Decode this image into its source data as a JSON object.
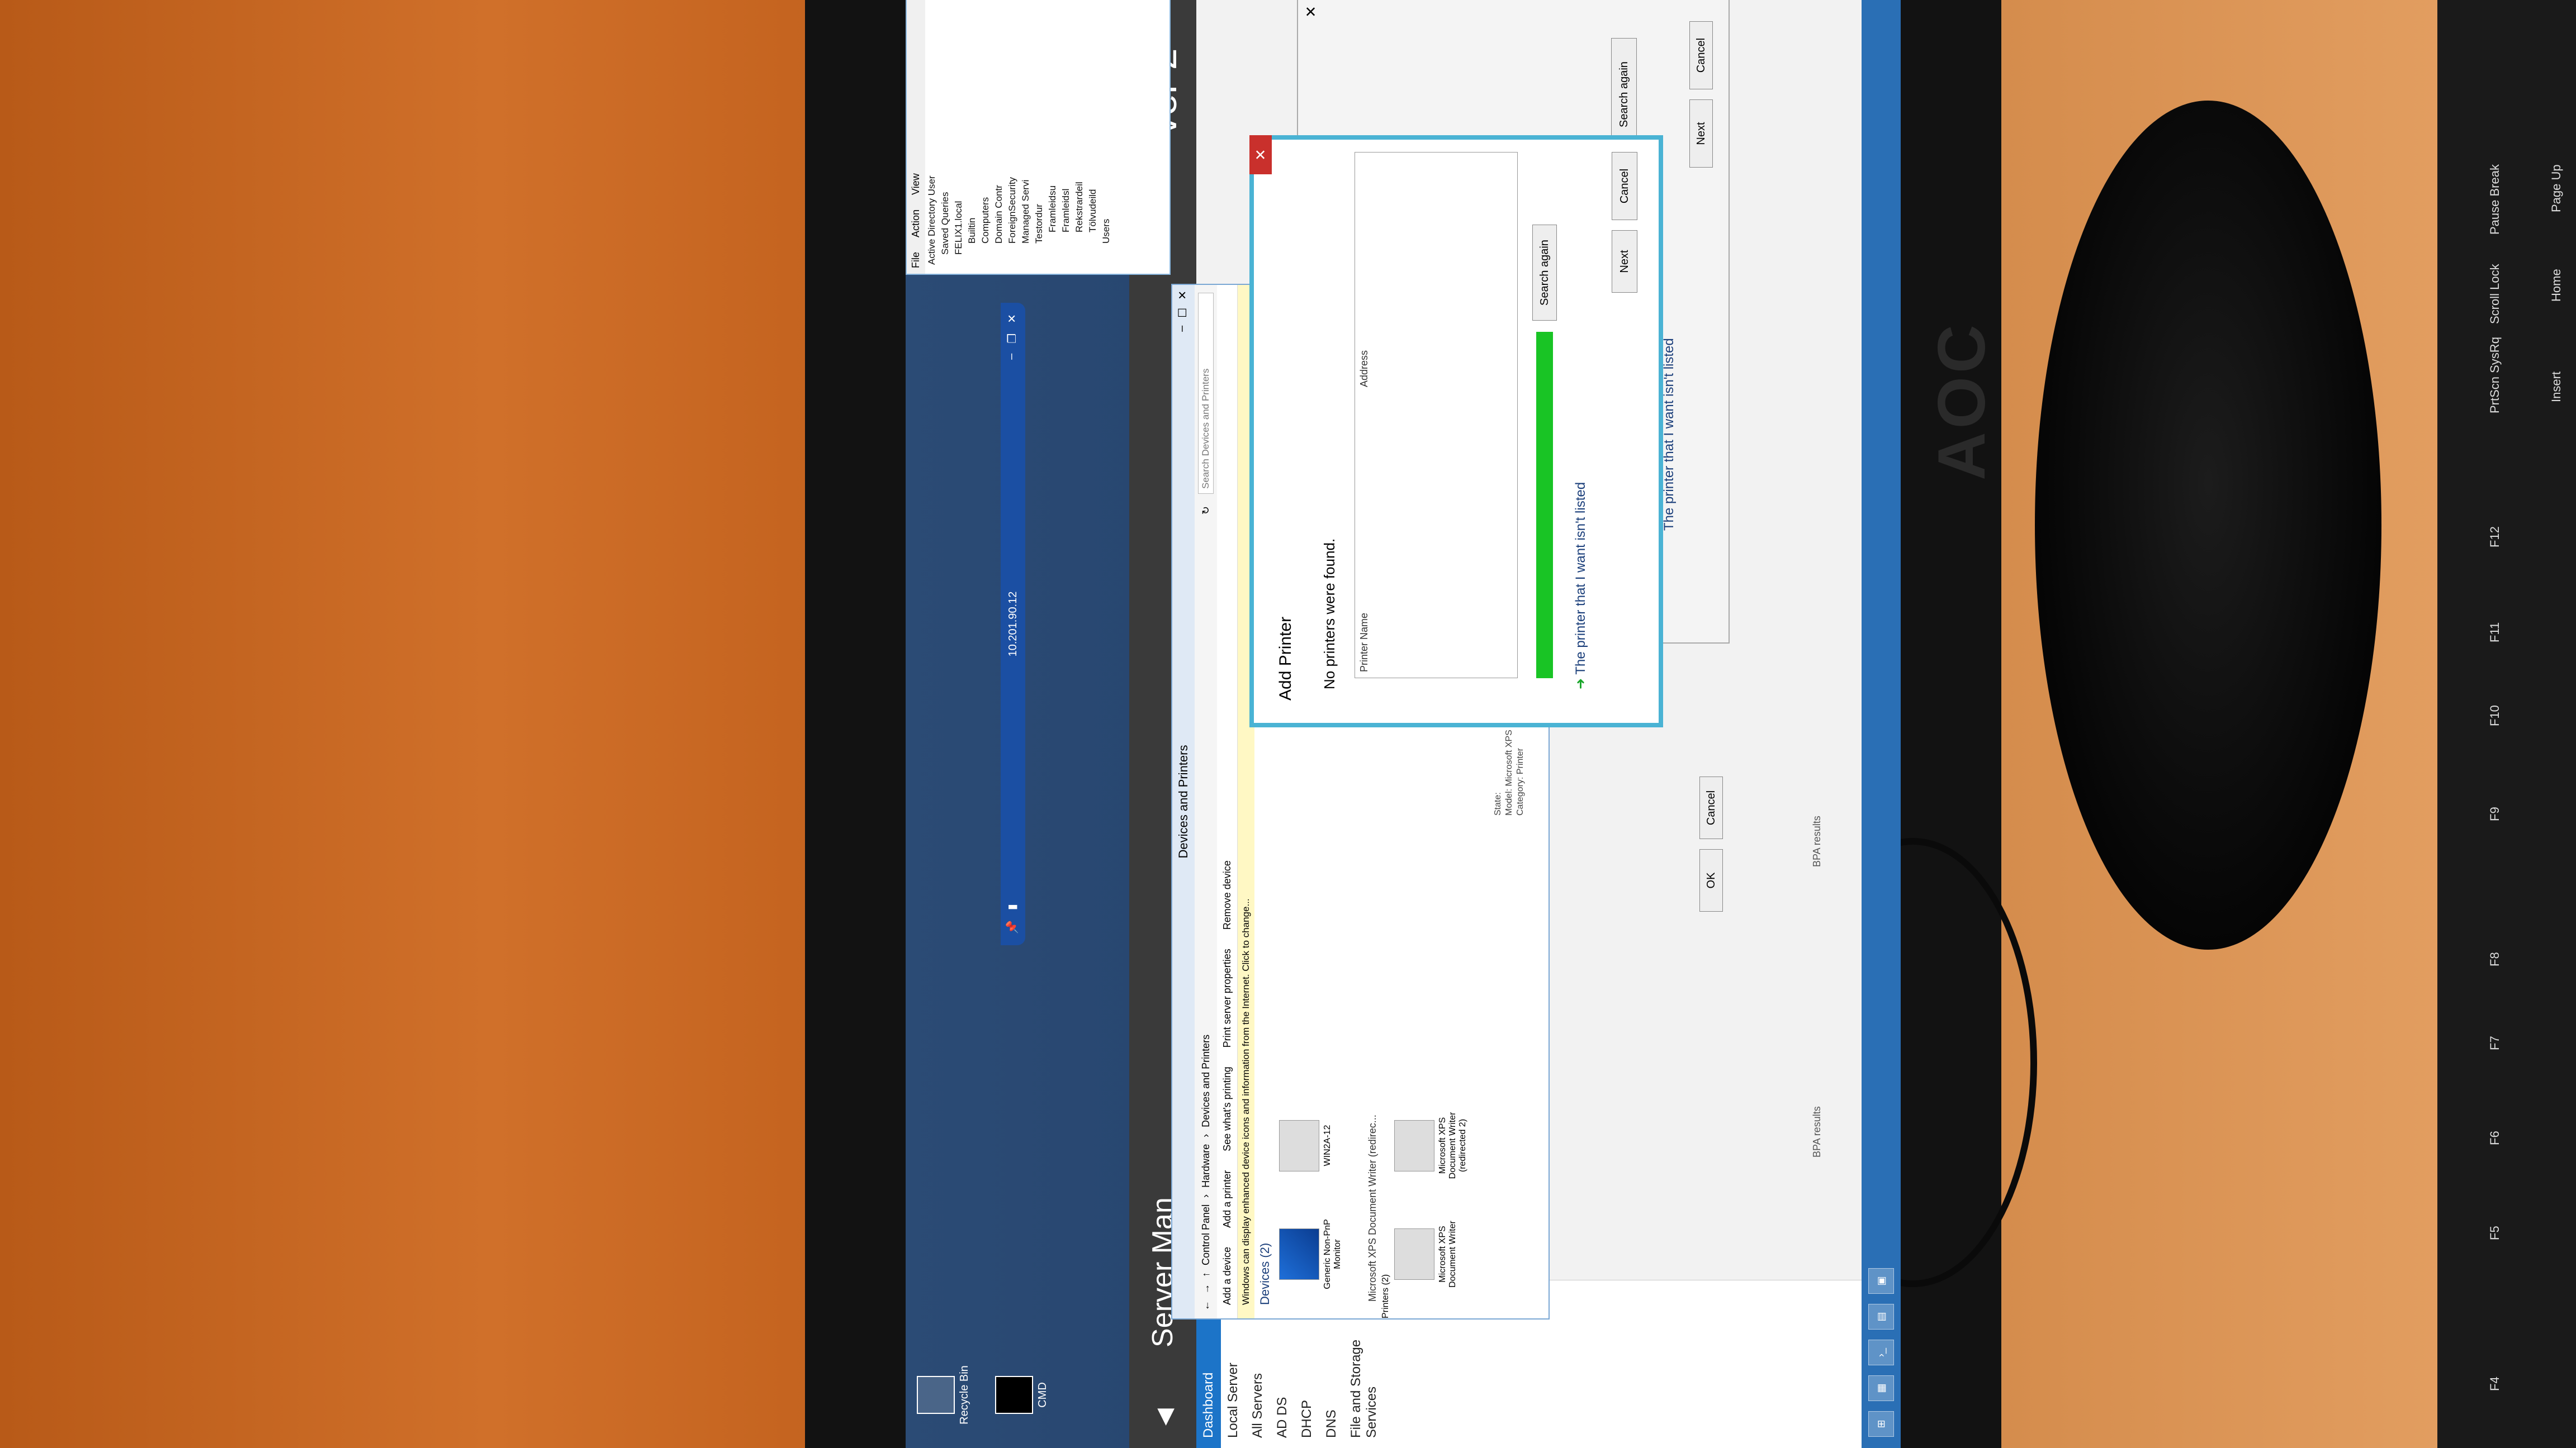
{
  "desktop": {
    "icons": [
      {
        "label": "Recycle Bin",
        "icon": "recycle-bin-icon"
      },
      {
        "label": "CMD",
        "icon": "cmd-icon"
      }
    ]
  },
  "rdp_bar": {
    "title": "10.201.90.12"
  },
  "server_manager": {
    "title": "Server Man",
    "version_fragment": "ver 2",
    "nav": [
      "Dashboard",
      "Local Server",
      "All Servers",
      "AD DS",
      "DHCP",
      "DNS",
      "File and Storage Services"
    ]
  },
  "aduc": {
    "menu": [
      "File",
      "Action",
      "View"
    ],
    "tree": [
      "Active Directory User",
      "Saved Queries",
      "FELIX1.local",
      "Builtin",
      "Computers",
      "Domain Contr",
      "ForeignSecurity",
      "Managed Servi",
      "Testordur",
      "Framleidsu",
      "Framleidsl",
      "Rekstrardeil",
      "Tölvudeild",
      "Users"
    ]
  },
  "devices_printers": {
    "title": "Devices and Printers",
    "breadcrumb": [
      "Control Panel",
      "Hardware",
      "Devices and Printers"
    ],
    "search_placeholder": "Search Devices and Printers",
    "toolbar": [
      "Add a device",
      "Add a printer",
      "See what's printing",
      "Print server properties",
      "Remove device"
    ],
    "info_bar": "Windows can display enhanced device icons and information from the Internet. Click to change...",
    "devices_header": "Devices (2)",
    "devices": [
      "Generic Non-PnP Monitor",
      "WIN2A-12"
    ],
    "printers_header": "Printers (2)",
    "printers": [
      "Microsoft XPS Document Writer",
      "Microsoft XPS Document Writer (redirected 2)"
    ],
    "details_name": "Microsoft XPS Document Writer (redirec...",
    "details_state_label": "State:",
    "details_model_label": "Model:",
    "details_model": "Microsoft XPS Docum...",
    "details_category_label": "Category:",
    "details_category": "Printer"
  },
  "add_printer": {
    "title": "Add Printer",
    "message": "No printers were found.",
    "columns": [
      "Printer Name",
      "Address"
    ],
    "search_again": "Search again",
    "not_listed": "The printer that I want isn't listed",
    "next": "Next",
    "cancel": "Cancel"
  },
  "background_dialog": {
    "search_again": "Search again",
    "not_listed": "The printer that I want isn't listed",
    "next": "Next",
    "cancel": "Cancel"
  },
  "ok_cancel": {
    "ok": "OK",
    "cancel": "Cancel"
  },
  "bpa": [
    "BPA results",
    "BPA results"
  ],
  "monitor": {
    "brand": "AOC"
  },
  "keyboard": [
    "F4",
    "F5",
    "F6",
    "F7",
    "F8",
    "F9",
    "F10",
    "F11",
    "F12",
    "PrtScn SysRq",
    "Scroll Lock",
    "Pause Break",
    "Insert",
    "Home",
    "Page Up"
  ]
}
